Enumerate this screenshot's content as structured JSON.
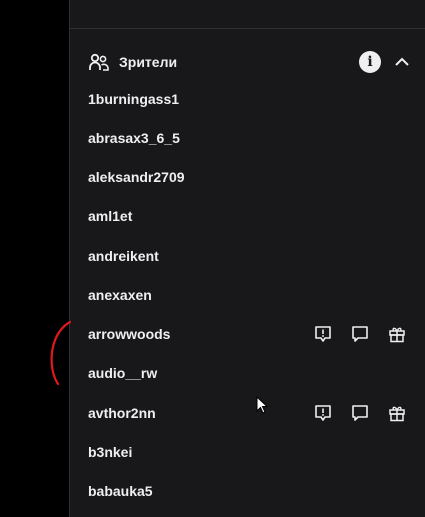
{
  "viewers": {
    "title": "Зрители",
    "info_icon": "info-icon",
    "collapse_icon": "chevron-up-icon",
    "users": [
      {
        "name": "1burningass1",
        "actions": false
      },
      {
        "name": "abrasax3_6_5",
        "actions": false
      },
      {
        "name": "aleksandr2709",
        "actions": false
      },
      {
        "name": "aml1et",
        "actions": false
      },
      {
        "name": "andreikent",
        "actions": false
      },
      {
        "name": "anexaxen",
        "actions": false
      },
      {
        "name": "arrowwoods",
        "actions": true
      },
      {
        "name": "audio__rw",
        "actions": false
      },
      {
        "name": "avthor2nn",
        "actions": true
      },
      {
        "name": "b3nkei",
        "actions": false
      },
      {
        "name": "babauka5",
        "actions": false
      }
    ],
    "action_icons": [
      "report-icon",
      "whisper-icon",
      "gift-icon"
    ]
  },
  "colors": {
    "background": "#18181b",
    "left_area": "#000000",
    "text": "#efeff1",
    "divider": "#2f2f35",
    "annotation": "#e0191e"
  }
}
